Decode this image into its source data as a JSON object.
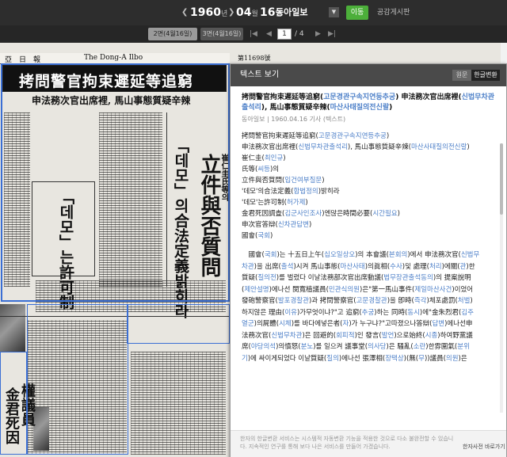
{
  "topbar": {
    "year": "1960",
    "year_unit": "년",
    "month": "04",
    "month_unit": "월",
    "day": "16",
    "day_unit": "일",
    "newspaper": "동아일보",
    "go_label": "이동",
    "board_link": "공감게시판"
  },
  "pagebar": {
    "tab1": "2면(4월16일)",
    "tab2": "3면(4월16일)",
    "current_page": "1",
    "total_pages": "/ 4"
  },
  "scan": {
    "masthead_left": "亞　日　報",
    "masthead_mid": "The Dong-A Ilbo",
    "masthead_right": "第11698號",
    "headline": "拷問警官拘束遲延等追窮",
    "subhead": "申法務次官出席裡, 馬山事態質疑辛辣",
    "title_vertical": "立件與否質問",
    "title_vertical2": "「데모」의合法定義밝히라",
    "small_vertical": "崔仁圭氏等의",
    "quote_vertical": "「데모」는許可制",
    "kim_vertical": "金君死因",
    "kim_vertical2": "權議員"
  },
  "panel": {
    "title": "텍스트 보기",
    "tab_original": "원문",
    "tab_hangul": "한글변환",
    "article_title_parts": [
      {
        "t": "拷問警官拘束遲延等追窮(",
        "hl": false
      },
      {
        "t": "고문경관구속지연등추궁",
        "hl": true
      },
      {
        "t": ") 申法務次官出席裡(",
        "hl": false
      },
      {
        "t": "신법무차관출석리",
        "hl": true
      },
      {
        "t": "), 馬山事態質疑辛辣(",
        "hl": false
      },
      {
        "t": "마산사태질의전신랄",
        "hl": true
      },
      {
        "t": ")",
        "hl": false
      }
    ],
    "meta": "동아일보 | 1960.04.16 기사 (텍스트)",
    "lines": [
      [
        {
          "t": "拷問警官拘束遲延等追窮(",
          "hl": false
        },
        {
          "t": "고문경관구속지연등추궁",
          "hl": true
        },
        {
          "t": ")",
          "hl": false
        }
      ],
      [
        {
          "t": "申法務次官出席裡(",
          "hl": false
        },
        {
          "t": "신법무차관출석리",
          "hl": true
        },
        {
          "t": "), 馬山事態質疑辛辣(",
          "hl": false
        },
        {
          "t": "마산사태질의전신랄",
          "hl": true
        },
        {
          "t": ")",
          "hl": false
        }
      ],
      [
        {
          "t": "崔仁圭(",
          "hl": false
        },
        {
          "t": "최인규",
          "hl": true
        },
        {
          "t": ")",
          "hl": false
        }
      ],
      [
        {
          "t": "氏等(",
          "hl": false
        },
        {
          "t": "씨등",
          "hl": true
        },
        {
          "t": ")의",
          "hl": false
        }
      ],
      [
        {
          "t": "立件與否質問(",
          "hl": false
        },
        {
          "t": "입건여부질문",
          "hl": true
        },
        {
          "t": ")",
          "hl": false
        }
      ],
      [
        {
          "t": "'데모'의合法定義(",
          "hl": false
        },
        {
          "t": "합법정의",
          "hl": true
        },
        {
          "t": ")밝히라",
          "hl": false
        }
      ],
      [
        {
          "t": "'데모'는許可制(",
          "hl": false
        },
        {
          "t": "허가제",
          "hl": true
        },
        {
          "t": ")",
          "hl": false
        }
      ],
      [
        {
          "t": "金君死因調査(",
          "hl": false
        },
        {
          "t": "김군사인조사",
          "hl": true
        },
        {
          "t": ")엔많은時間必要(",
          "hl": false
        },
        {
          "t": "시간필요",
          "hl": true
        },
        {
          "t": ")",
          "hl": false
        }
      ],
      [
        {
          "t": "申次官答辯(",
          "hl": false
        },
        {
          "t": "신차관답변",
          "hl": true
        },
        {
          "t": ")",
          "hl": false
        }
      ],
      [
        {
          "t": "國會(",
          "hl": false
        },
        {
          "t": "국회",
          "hl": true
        },
        {
          "t": ")",
          "hl": false
        }
      ]
    ],
    "body_lines": [
      [
        {
          "t": "　國會(",
          "hl": false
        },
        {
          "t": "국회",
          "hl": true
        },
        {
          "t": ")는 十五日上午(",
          "hl": false
        },
        {
          "t": "십오일상오",
          "hl": true
        },
        {
          "t": ")의 本會議(",
          "hl": false
        },
        {
          "t": "본회의",
          "hl": true
        },
        {
          "t": ")에서 申法務次官(",
          "hl": false
        },
        {
          "t": "신법무",
          "hl": true
        }
      ],
      [
        {
          "t": "차관",
          "hl": true
        },
        {
          "t": ")을 出席(",
          "hl": false
        },
        {
          "t": "출석",
          "hl": true
        },
        {
          "t": ")시켜 馬山事態(",
          "hl": false
        },
        {
          "t": "마산사태",
          "hl": true
        },
        {
          "t": ")의眞相(",
          "hl": false
        },
        {
          "t": "수사",
          "hl": true
        },
        {
          "t": ")및 處理(",
          "hl": false
        },
        {
          "t": "처리",
          "hl": true
        },
        {
          "t": ")에關(",
          "hl": false
        },
        {
          "t": "관",
          "hl": true
        },
        {
          "t": ")한",
          "hl": false
        }
      ],
      [
        {
          "t": "質疑(",
          "hl": false
        },
        {
          "t": "질의전",
          "hl": true
        },
        {
          "t": ")를 벌렸다 이날法務部次官出席動議(",
          "hl": false
        },
        {
          "t": "법무장관출석동의",
          "hl": true
        },
        {
          "t": ")의 提案說明",
          "hl": false
        }
      ],
      [
        {
          "t": "(",
          "hl": false
        },
        {
          "t": "제안설명",
          "hl": true
        },
        {
          "t": ")에나선 閔寬植議員(",
          "hl": false
        },
        {
          "t": "민관식의원",
          "hl": true
        },
        {
          "t": ")은\"第一馬山事件(",
          "hl": false
        },
        {
          "t": "제일마산사건",
          "hl": true
        },
        {
          "t": ")이었어",
          "hl": false
        }
      ],
      [
        {
          "t": "發砲警察官(",
          "hl": false
        },
        {
          "t": "발포경찰관",
          "hl": true
        },
        {
          "t": ")과 拷問警察官(",
          "hl": false
        },
        {
          "t": "고문경찰관",
          "hl": true
        },
        {
          "t": ")을 卽時(",
          "hl": false
        },
        {
          "t": "즉각",
          "hl": true
        },
        {
          "t": ")체포處罰(",
          "hl": false
        },
        {
          "t": "처벌",
          "hl": true
        },
        {
          "t": ")",
          "hl": false
        }
      ],
      [
        {
          "t": "하지않은 理由(",
          "hl": false
        },
        {
          "t": "이유",
          "hl": true
        },
        {
          "t": ")가무엇이냐?\"고 追窮(",
          "hl": false
        },
        {
          "t": "추궁",
          "hl": true
        },
        {
          "t": ")하는 同時(",
          "hl": false
        },
        {
          "t": "동시",
          "hl": true
        },
        {
          "t": ")에\"金朱烈君(",
          "hl": false
        },
        {
          "t": "김주",
          "hl": true
        }
      ],
      [
        {
          "t": "열군",
          "hl": true
        },
        {
          "t": ")의屍體(",
          "hl": false
        },
        {
          "t": "시체",
          "hl": true
        },
        {
          "t": ")를 바다에넣은者(",
          "hl": false
        },
        {
          "t": "자",
          "hl": true
        },
        {
          "t": ")가 누구냐?\"고따졌으나答辯(",
          "hl": false
        },
        {
          "t": "답변",
          "hl": true
        },
        {
          "t": ")에나선申",
          "hl": false
        }
      ],
      [
        {
          "t": "法務次官(",
          "hl": false
        },
        {
          "t": "신법무차관",
          "hl": true
        },
        {
          "t": ")은 回避的(",
          "hl": false
        },
        {
          "t": "회피적",
          "hl": true
        },
        {
          "t": ")인 發言(",
          "hl": false
        },
        {
          "t": "발언",
          "hl": true
        },
        {
          "t": ")으로始終(",
          "hl": false
        },
        {
          "t": "시종",
          "hl": true
        },
        {
          "t": ")하여野黨議",
          "hl": false
        }
      ],
      [
        {
          "t": "席(",
          "hl": false
        },
        {
          "t": "야당의석",
          "hl": true
        },
        {
          "t": ")의憤怒(",
          "hl": false
        },
        {
          "t": "분노",
          "hl": true
        },
        {
          "t": ")를 일으켜 議事堂(",
          "hl": false
        },
        {
          "t": "의사당",
          "hl": true
        },
        {
          "t": ")은 騷亂(",
          "hl": false
        },
        {
          "t": "소란",
          "hl": true
        },
        {
          "t": ")한雰圍氣(",
          "hl": false
        },
        {
          "t": "분위",
          "hl": true
        }
      ],
      [
        {
          "t": "기",
          "hl": true
        },
        {
          "t": ")에 싸이게되었다 이날質疑(",
          "hl": false
        },
        {
          "t": "질의",
          "hl": true
        },
        {
          "t": ")에나선 張澤相(",
          "hl": false
        },
        {
          "t": "장택상",
          "hl": true
        },
        {
          "t": ")(無(",
          "hl": false
        },
        {
          "t": "무",
          "hl": true
        },
        {
          "t": "))議員(",
          "hl": false
        },
        {
          "t": "의원",
          "hl": true
        },
        {
          "t": ")은",
          "hl": false
        }
      ]
    ],
    "footer_notice": "한자의 한글변환 서비스는 시스템적 자동변환 기능을 적용한 것으로 다소 불완전할 수 있습니다. 지속적인 연구를 통해 보다 나은 서비스를 만들어 가겠습니다.",
    "footer_link": "한자사전 바로가기"
  },
  "icons": {
    "prev": "chevron-left-icon",
    "next": "chevron-right-icon",
    "first": "first-page-icon",
    "last": "last-page-icon",
    "dropdown": "chevron-down-icon"
  }
}
